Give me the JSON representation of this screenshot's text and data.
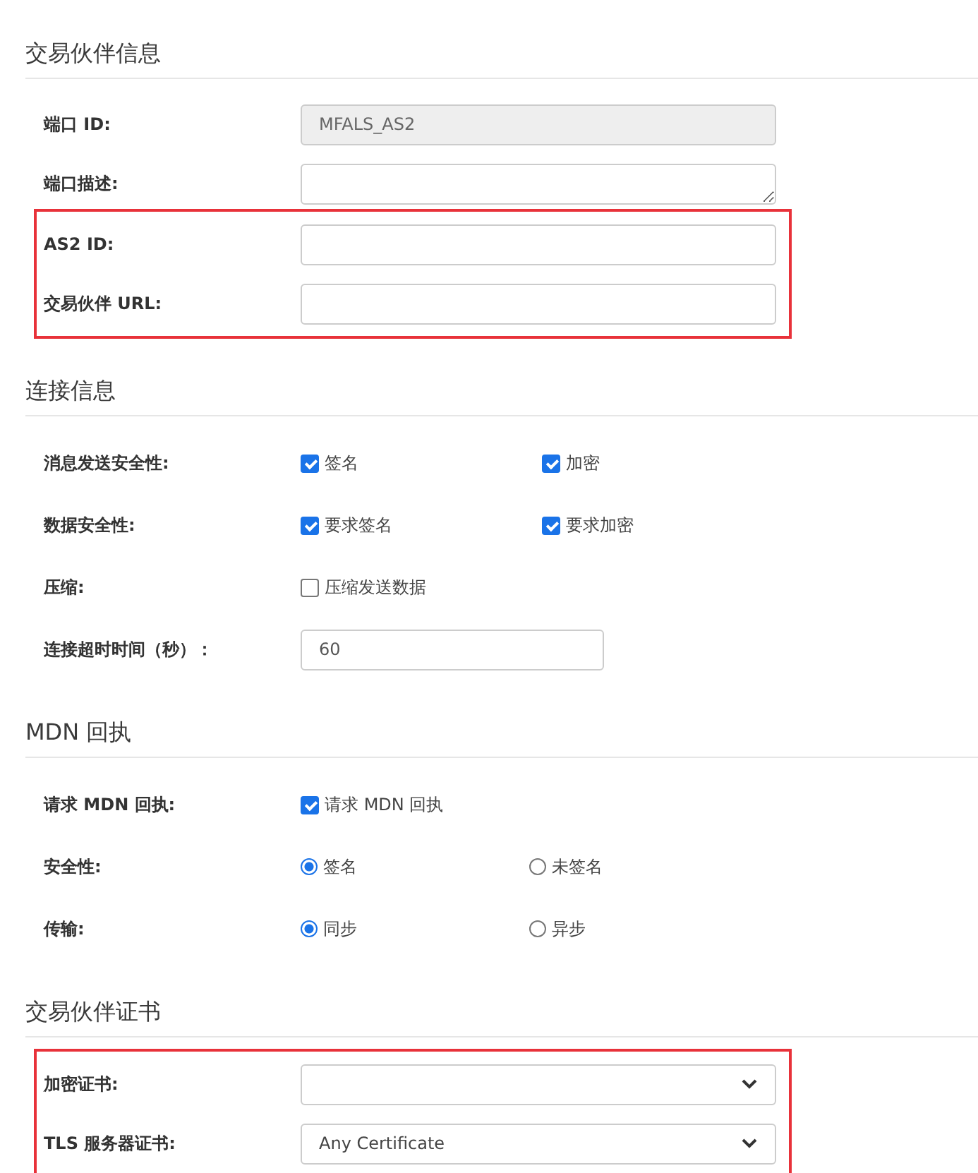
{
  "sections": [
    {
      "title": "交易伙伴信息",
      "groups": [
        {
          "highlighted": false,
          "rows": [
            {
              "kind": "input",
              "label": "端口 ID:",
              "value": "MFALS_AS2",
              "disabled": true
            },
            {
              "kind": "textarea",
              "label": "端口描述:"
            }
          ]
        },
        {
          "highlighted": true,
          "rows": [
            {
              "kind": "input",
              "label": "AS2 ID:",
              "disabled": false
            },
            {
              "kind": "input",
              "label": "交易伙伴 URL:",
              "disabled": false
            }
          ]
        }
      ]
    },
    {
      "title": "连接信息",
      "groups": [
        {
          "highlighted": false,
          "rows": [
            {
              "kind": "checks",
              "label": "消息发送安全性:",
              "options": [
                {
                  "label": "签名",
                  "checked": true
                },
                {
                  "label": "加密",
                  "checked": true
                }
              ]
            },
            {
              "kind": "checks",
              "label": "数据安全性:",
              "options": [
                {
                  "label": "要求签名",
                  "checked": true
                },
                {
                  "label": "要求加密",
                  "checked": true
                }
              ]
            },
            {
              "kind": "checks",
              "label": "压缩:",
              "options": [
                {
                  "label": "压缩发送数据",
                  "checked": false
                }
              ]
            },
            {
              "kind": "short_input",
              "label": "连接超时时间（秒）：",
              "value": "60",
              "disabled": false
            }
          ]
        }
      ]
    },
    {
      "title": "MDN 回执",
      "groups": [
        {
          "highlighted": false,
          "rows": [
            {
              "kind": "checks",
              "label": "请求 MDN 回执:",
              "options": [
                {
                  "label": "请求 MDN 回执",
                  "checked": true
                }
              ]
            },
            {
              "kind": "radios",
              "label": "安全性:",
              "options": [
                {
                  "label": "签名",
                  "selected": true
                },
                {
                  "label": "未签名",
                  "selected": false
                }
              ]
            },
            {
              "kind": "radios",
              "label": "传输:",
              "options": [
                {
                  "label": "同步",
                  "selected": true
                },
                {
                  "label": "异步",
                  "selected": false
                }
              ]
            }
          ]
        }
      ]
    },
    {
      "title": "交易伙伴证书",
      "groups": [
        {
          "highlighted": true,
          "rows": [
            {
              "kind": "select",
              "label": "加密证书:"
            },
            {
              "kind": "select",
              "label": "TLS 服务器证书:",
              "value": "Any Certificate"
            }
          ]
        }
      ]
    }
  ]
}
